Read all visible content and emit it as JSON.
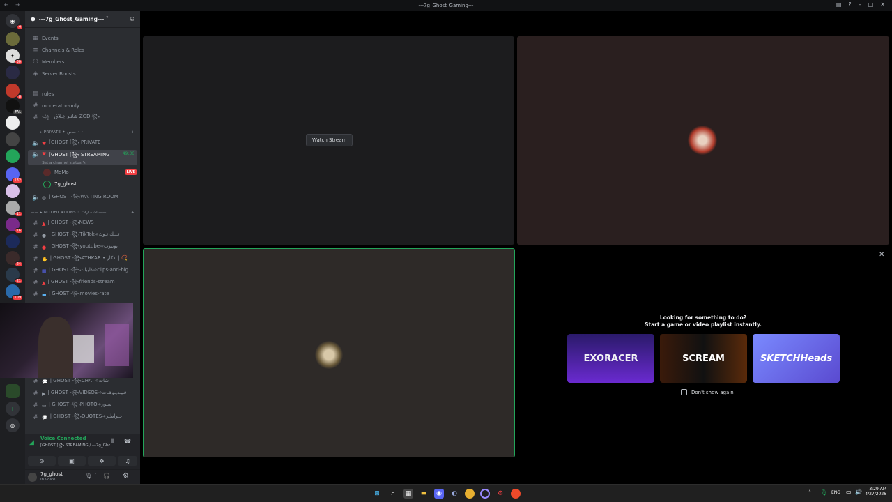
{
  "window": {
    "title": "---7g_Ghost_Gaming---",
    "nav": "← →"
  },
  "server": {
    "name": "---7g_Ghost_Gaming--- ˅"
  },
  "guild_badges": [
    "4",
    "",
    "30",
    "",
    "8",
    "FAL",
    "",
    "",
    "",
    "132",
    "",
    "11",
    "16",
    "",
    "24",
    "21",
    "109"
  ],
  "nav_items": [
    "Events",
    "Channels & Roles",
    "Members",
    "Server Boosts"
  ],
  "channels_top": [
    {
      "name": "rules"
    },
    {
      "name": "moderator-only"
    },
    {
      "name": "꧁ | شاتـر عِـلاق ZGD-꧂"
    }
  ],
  "category_private": "—— ▸ PRIVATE ✦ خـاص ◦ ◦",
  "voice_private": "⌈GHOST ⌈꧂ PRIVATE",
  "voice_streaming": {
    "name": "⌈GHOST ⌈꧂ STREAMING",
    "time": "49:36",
    "status": "Set a channel status ✎"
  },
  "voice_members": [
    {
      "name": "MoMo",
      "badge": "LIVE"
    },
    {
      "name": "7g_ghost",
      "badge": ""
    }
  ],
  "voice_waiting": "| GHOST -꧂WAITING ROOM",
  "category_notifications": "—— ▸ NOTIFICATIONS ◦ اشـعـارات ——",
  "channels_notif": [
    "| GHOST -꧂NEWS",
    "| GHOST -꧂TikTok➾تـيـك تـوك",
    "| GHOST -꧂youtube➾يوتيوب",
    "| GHOST -꧂ATHKAR • اذكار | 📿",
    "| GHOST -꧂كليبات➾clips-and-hig...",
    "| GHOST -꧂friends-stream",
    "| GHOST -꧂movies-rate"
  ],
  "channels_bottom": [
    "| GHOST -꧂CHAT➾شات",
    "| GHOST -꧂VIDEOS➾فـيـديـوهـات",
    "| GHOST -꧂PHOTO➾صـور",
    "| GHOST -꧂QUOTES➾خـواطـر"
  ],
  "voice_panel": {
    "status": "Voice Connected",
    "channel": "⌈GHOST ⌈꧂ STREAMING / ---7g_Ghost..."
  },
  "user": {
    "name": "7g_ghost",
    "status": "In voice"
  },
  "stream": {
    "watch_label": "Watch Stream"
  },
  "activity": {
    "close": "✕",
    "line1": "Looking for something to do?",
    "line2": "Start a game or video playlist instantly.",
    "cards": [
      {
        "title": "EXORACER",
        "bg": "#3b1f7a"
      },
      {
        "title": "SCREAM",
        "bg": "#1a1a1a"
      },
      {
        "title": "SKETCHHeads",
        "bg": "#6b7cff"
      }
    ],
    "dont_show": "Don't show again"
  },
  "tray": {
    "lang": "ENG",
    "time": "3:29 AM",
    "date": "4/27/2026"
  },
  "colors": {
    "green": "#23a55a",
    "red": "#f23f43",
    "blurple": "#5865f2"
  }
}
